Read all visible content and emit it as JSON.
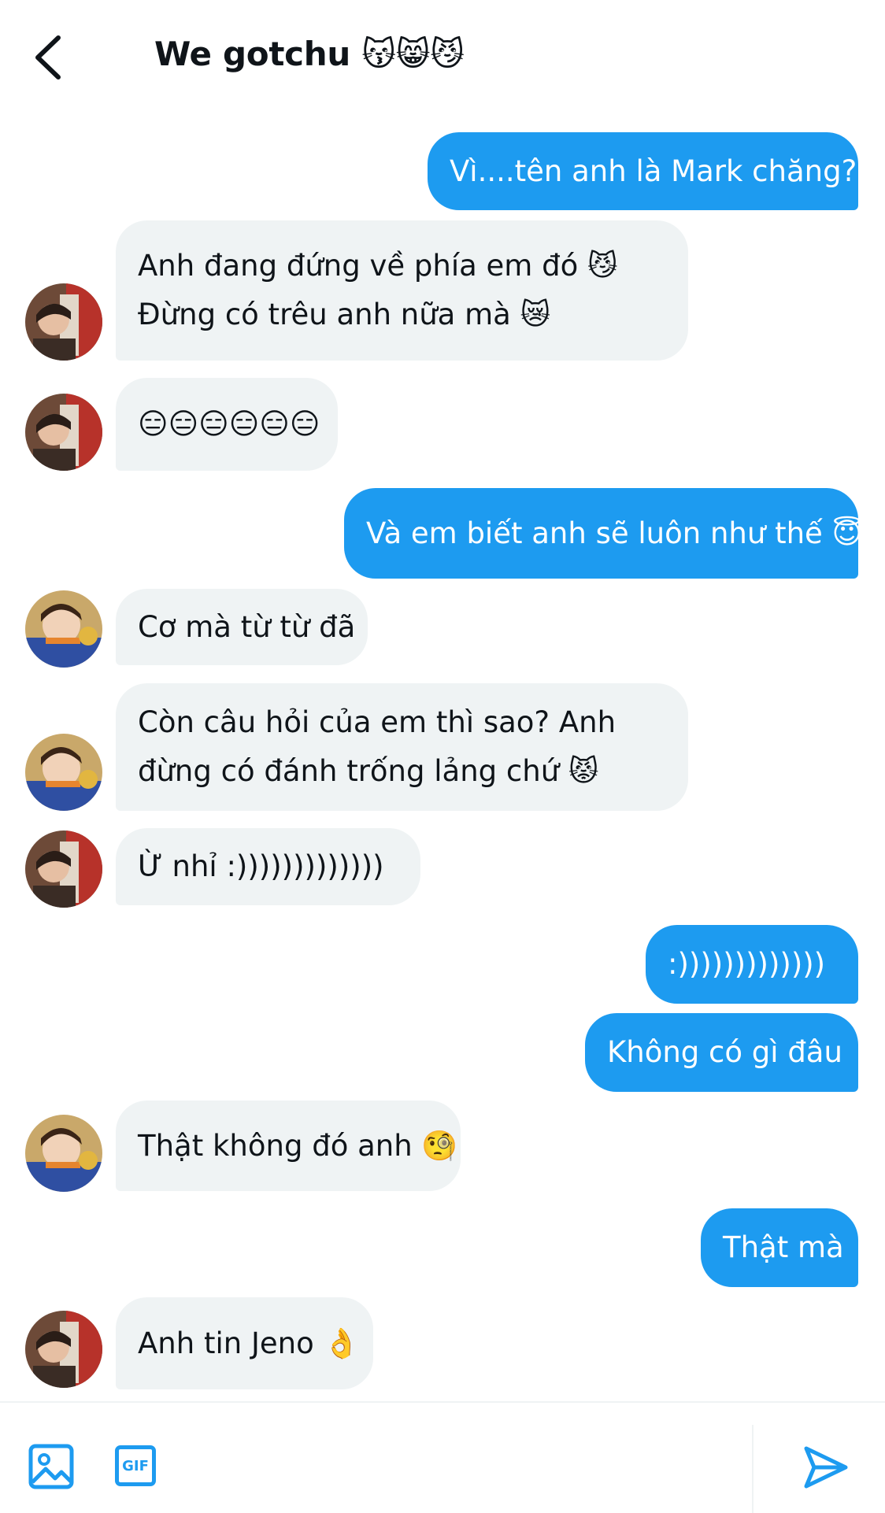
{
  "header": {
    "title": "We gotchu 😽😸😼"
  },
  "messages": [
    {
      "side": "out",
      "lines": [
        "Vì....tên anh là Mark chăng?"
      ]
    },
    {
      "side": "in",
      "avatar": "avatar-a",
      "lines": [
        "Anh đang đứng về phía em đó 😼",
        "Đừng có trêu anh nữa mà 😿"
      ]
    },
    {
      "side": "in",
      "avatar": "avatar-a",
      "lines": [
        "😑😑😑😑😑😑"
      ]
    },
    {
      "side": "out",
      "lines": [
        "Và em biết anh sẽ luôn như thế 😇"
      ]
    },
    {
      "side": "in",
      "avatar": "avatar-b",
      "lines": [
        "Cơ mà từ từ đã"
      ]
    },
    {
      "side": "in",
      "avatar": "avatar-b",
      "lines": [
        "Còn câu hỏi của em thì sao? Anh",
        "đừng có đánh trống lảng chứ 😾"
      ]
    },
    {
      "side": "in",
      "avatar": "avatar-a",
      "lines": [
        "Ừ nhỉ :)))))))))))))"
      ]
    },
    {
      "side": "out",
      "lines": [
        ":)))))))))))))"
      ]
    },
    {
      "side": "out",
      "lines": [
        "Không có gì đâu"
      ]
    },
    {
      "side": "in",
      "avatar": "avatar-b",
      "lines": [
        "Thật không đó anh 🧐"
      ]
    },
    {
      "side": "out",
      "lines": [
        "Thật mà"
      ]
    },
    {
      "side": "in",
      "avatar": "avatar-a",
      "lines": [
        "Anh tin Jeno 👌"
      ]
    }
  ],
  "composer": {
    "gif_label": "GIF"
  },
  "colors": {
    "accent": "#1d9bf0",
    "incoming_bubble": "#eff3f4"
  }
}
